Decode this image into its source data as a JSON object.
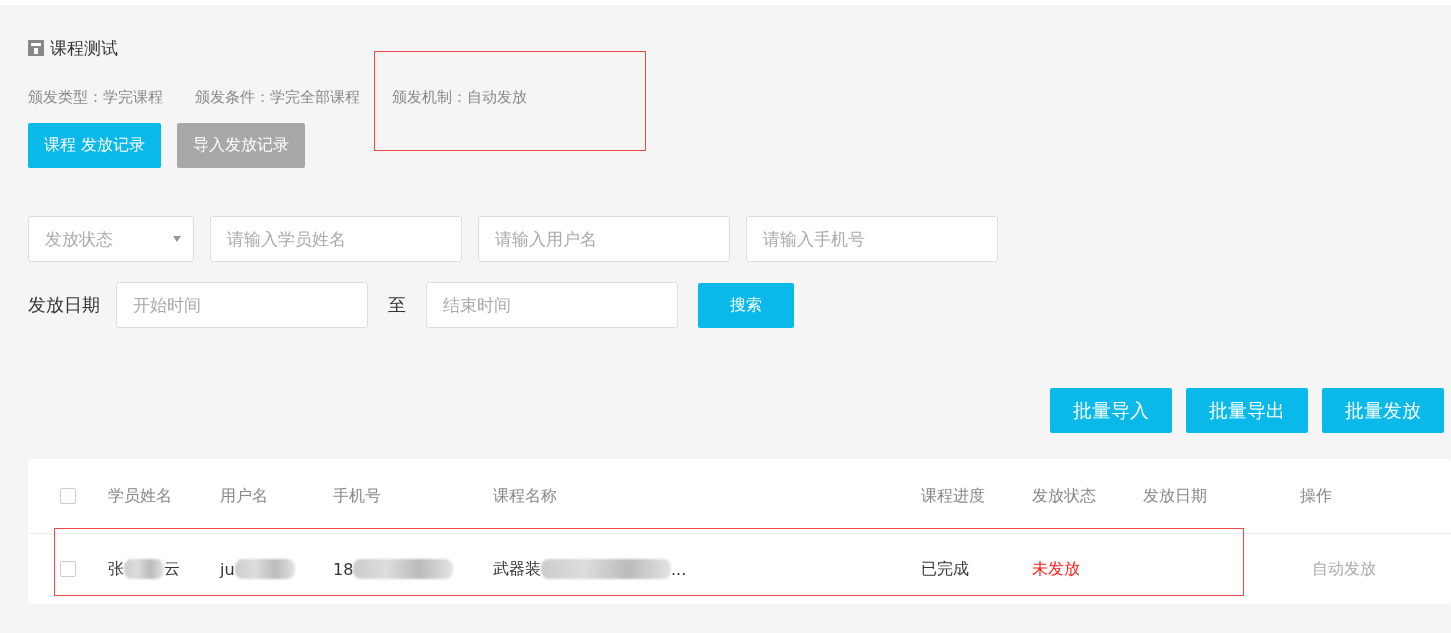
{
  "title": "课程测试",
  "info": [
    {
      "label": "颁发类型：学完课程",
      "highlighted": false
    },
    {
      "label": "颁发条件：学完全部课程",
      "highlighted": false
    },
    {
      "label": "颁发机制：自动发放",
      "highlighted": true
    }
  ],
  "actions": [
    {
      "label": "课程 发放记录",
      "disabled": false
    },
    {
      "label": "导入发放记录",
      "disabled": true
    }
  ],
  "filters": {
    "status_select": {
      "placeholder": "发放状态"
    },
    "name": {
      "placeholder": "请输入学员姓名"
    },
    "username": {
      "placeholder": "请输入用户名"
    },
    "phone": {
      "placeholder": "请输入手机号"
    },
    "date_label": "发放日期",
    "start": {
      "placeholder": "开始时间"
    },
    "separator": "至",
    "end": {
      "placeholder": "结束时间"
    },
    "search_button": "搜索"
  },
  "batch_buttons": [
    "批量导入",
    "批量导出",
    "批量发放"
  ],
  "table": {
    "columns": [
      "学员姓名",
      "用户名",
      "手机号",
      "课程名称",
      "课程进度",
      "发放状态",
      "发放日期",
      "操作"
    ],
    "select_all_checked": false,
    "rows": [
      {
        "checked": false,
        "highlighted": true,
        "name": {
          "before": "张",
          "after": "云"
        },
        "username": {
          "before": "ju"
        },
        "phone": {
          "before": "18"
        },
        "course": {
          "before": "武器装",
          "after": "..."
        },
        "progress": "已完成",
        "status": "未发放",
        "issued": false,
        "operation": "自动发放"
      }
    ]
  }
}
